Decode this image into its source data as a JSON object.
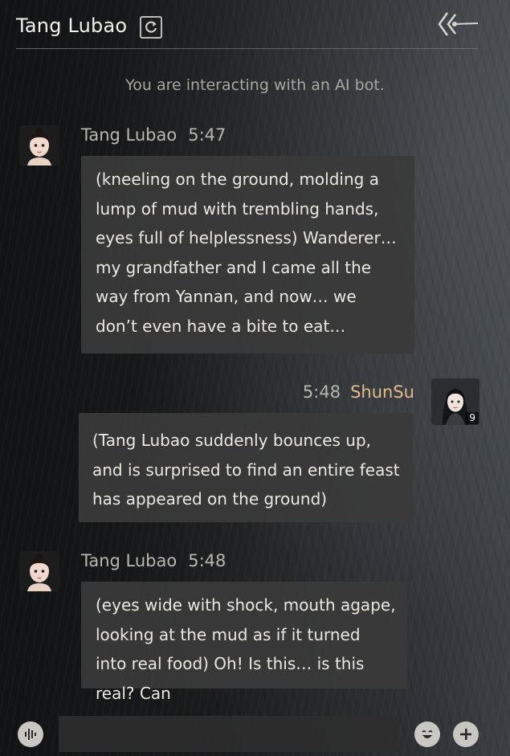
{
  "header": {
    "title": "Tang Lubao",
    "refresh_icon": "refresh-icon",
    "collapse_icon": "double-chevron-left-icon"
  },
  "notice": "You are interacting with an AI bot.",
  "messages": [
    {
      "sender": "Tang Lubao",
      "time": "5:47",
      "side": "left",
      "text": "(kneeling on the ground, molding a lump of mud with trembling hands, eyes full of helplessness) Wanderer… my grandfather and I came all the way from Yannan, and now… we don’t even have a bite to eat…"
    },
    {
      "sender": "ShunSu",
      "time": "5:48",
      "side": "right",
      "level": "9",
      "text": "(Tang Lubao suddenly bounces up, and is surprised to find an entire feast has appeared on the ground)"
    },
    {
      "sender": "Tang Lubao",
      "time": "5:48",
      "side": "left",
      "text": "(eyes wide with shock, mouth agape, looking at the mud as if it turned into real food) Oh! Is this… is this real? Can"
    }
  ],
  "input_bar": {
    "voice_icon": "voice-icon",
    "emoji_icon": "emoji-icon",
    "add_icon": "plus-icon",
    "placeholder": ""
  },
  "colors": {
    "bubble": "#3a3a3a",
    "player_name": "#e6b98a",
    "text": "#ebe8e2"
  }
}
